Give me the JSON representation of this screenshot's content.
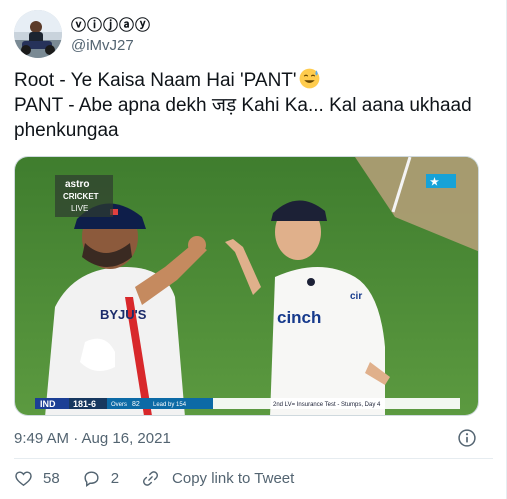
{
  "tweet": {
    "author": {
      "display_name": "ⓥⓘⓙⓐⓨ",
      "handle": "@iMvJ27"
    },
    "text_lines": [
      "Root - Ye Kaisa Naam Hai 'PANT'",
      "PANT - Abe apna dekh जड़ Kahi Ka... Kal aana ukhaad",
      "phenkungaa"
    ],
    "emoji": "sweat-smile-emoji",
    "media": {
      "broadcaster_top": "astro",
      "broadcaster_mid": "CRICKET",
      "broadcaster_bottom": "LIVE",
      "score_team": "IND",
      "score_value": "181-6",
      "overs_label": "Overs",
      "overs_value": "82",
      "lead_text": "Lead by 154",
      "match_text": "2nd LV= Insurance Test - Stumps, Day 4",
      "shirt_sponsor_left": "BYJU'S",
      "shirt_sponsor_right": "cinch",
      "sleeve_text": "cir"
    },
    "timestamp": "9:49 AM · Aug 16, 2021",
    "actions": {
      "likes": "58",
      "replies": "2",
      "copy_link_label": "Copy link to Tweet"
    }
  },
  "colors": {
    "text_primary": "#0f1419",
    "text_secondary": "#536471",
    "like": "#536471",
    "grass": "#4d8a36"
  }
}
